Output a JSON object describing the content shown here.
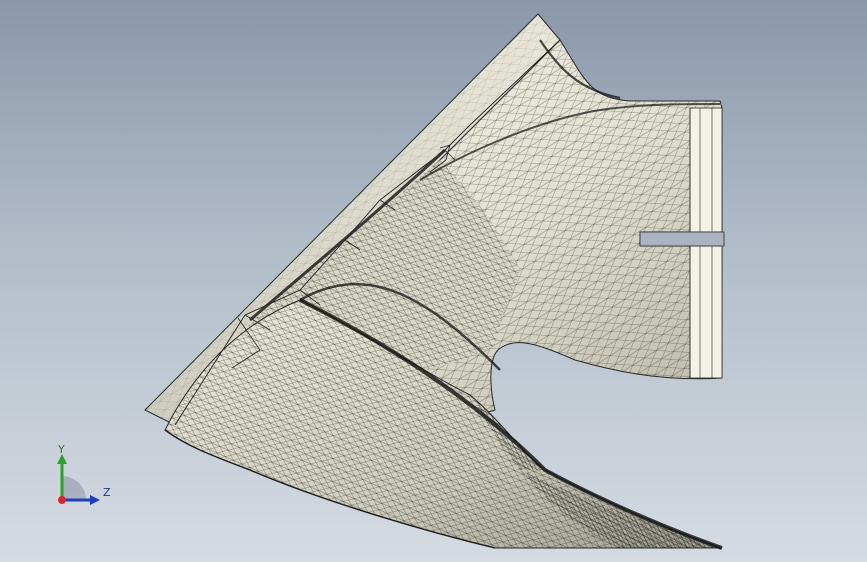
{
  "viewport": {
    "background_top": "#8b97aa",
    "background_bottom": "#d6dbe2",
    "model_fill": "#e6e4d6",
    "model_fill_light": "#f6f5ec",
    "model_fill_shadow": "#bcbaaa",
    "mesh_color": "#1a1a1a"
  },
  "triad": {
    "y_label": "Y",
    "z_label": "Z",
    "y_color": "#2ca02c",
    "z_color": "#1f3fbf",
    "x_color": "#d62728"
  }
}
